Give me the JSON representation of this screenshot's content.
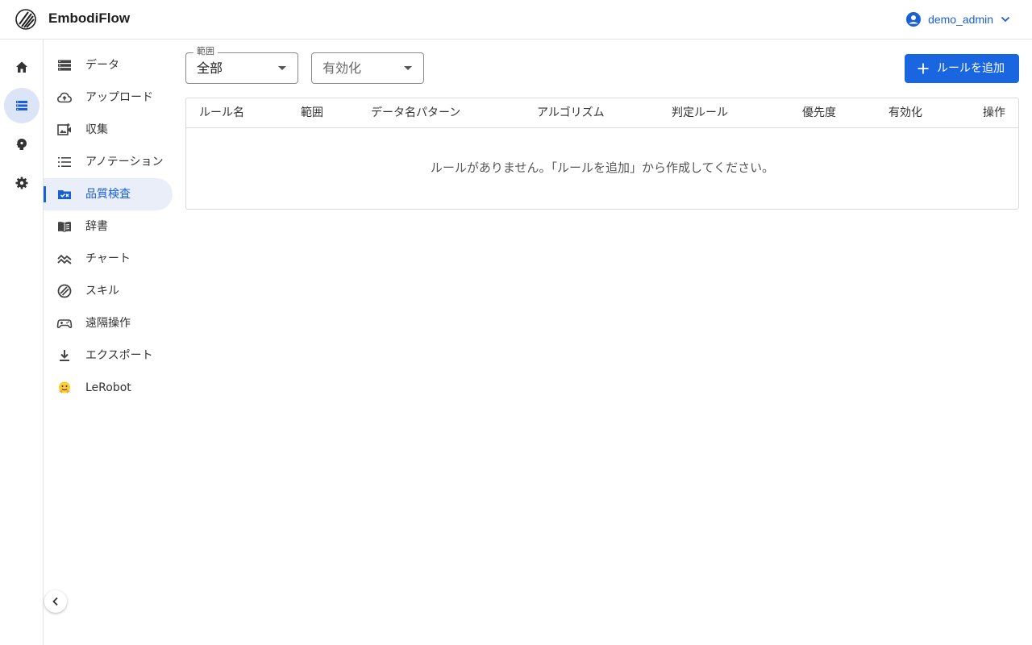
{
  "header": {
    "app_title": "EmbodiFlow",
    "user_name": "demo_admin"
  },
  "rail": {
    "items": [
      {
        "name": "home-icon",
        "active": false
      },
      {
        "name": "storage-icon",
        "active": true
      },
      {
        "name": "brain-icon",
        "active": false
      },
      {
        "name": "gear-icon",
        "active": false
      }
    ]
  },
  "sidebar": {
    "items": [
      {
        "label": "データ",
        "icon": "storage-icon"
      },
      {
        "label": "アップロード",
        "icon": "cloud-upload-icon"
      },
      {
        "label": "収集",
        "icon": "video-add-icon"
      },
      {
        "label": "アノテーション",
        "icon": "list-icon"
      },
      {
        "label": "品質検査",
        "icon": "folder-check-icon",
        "active": true
      },
      {
        "label": "辞書",
        "icon": "book-icon"
      },
      {
        "label": "チャート",
        "icon": "chart-line-icon"
      },
      {
        "label": "スキル",
        "icon": "skill-icon"
      },
      {
        "label": "遠隔操作",
        "icon": "gamepad-icon"
      },
      {
        "label": "エクスポート",
        "icon": "download-icon"
      },
      {
        "label": "LeRobot",
        "icon": "hugging-face-icon"
      }
    ]
  },
  "filters": {
    "scope": {
      "legend": "範囲",
      "value": "全部"
    },
    "enabled": {
      "placeholder": "有効化"
    }
  },
  "actions": {
    "add_rule_label": "ルールを追加"
  },
  "table": {
    "columns": [
      "ルール名",
      "範囲",
      "データ名パターン",
      "アルゴリズム",
      "判定ルール",
      "優先度",
      "有効化",
      "操作"
    ],
    "empty_message": "ルールがありません。「ルールを追加」から作成してください。"
  },
  "colors": {
    "accent": "#1a66e0",
    "active_bg": "#e9eef8"
  }
}
